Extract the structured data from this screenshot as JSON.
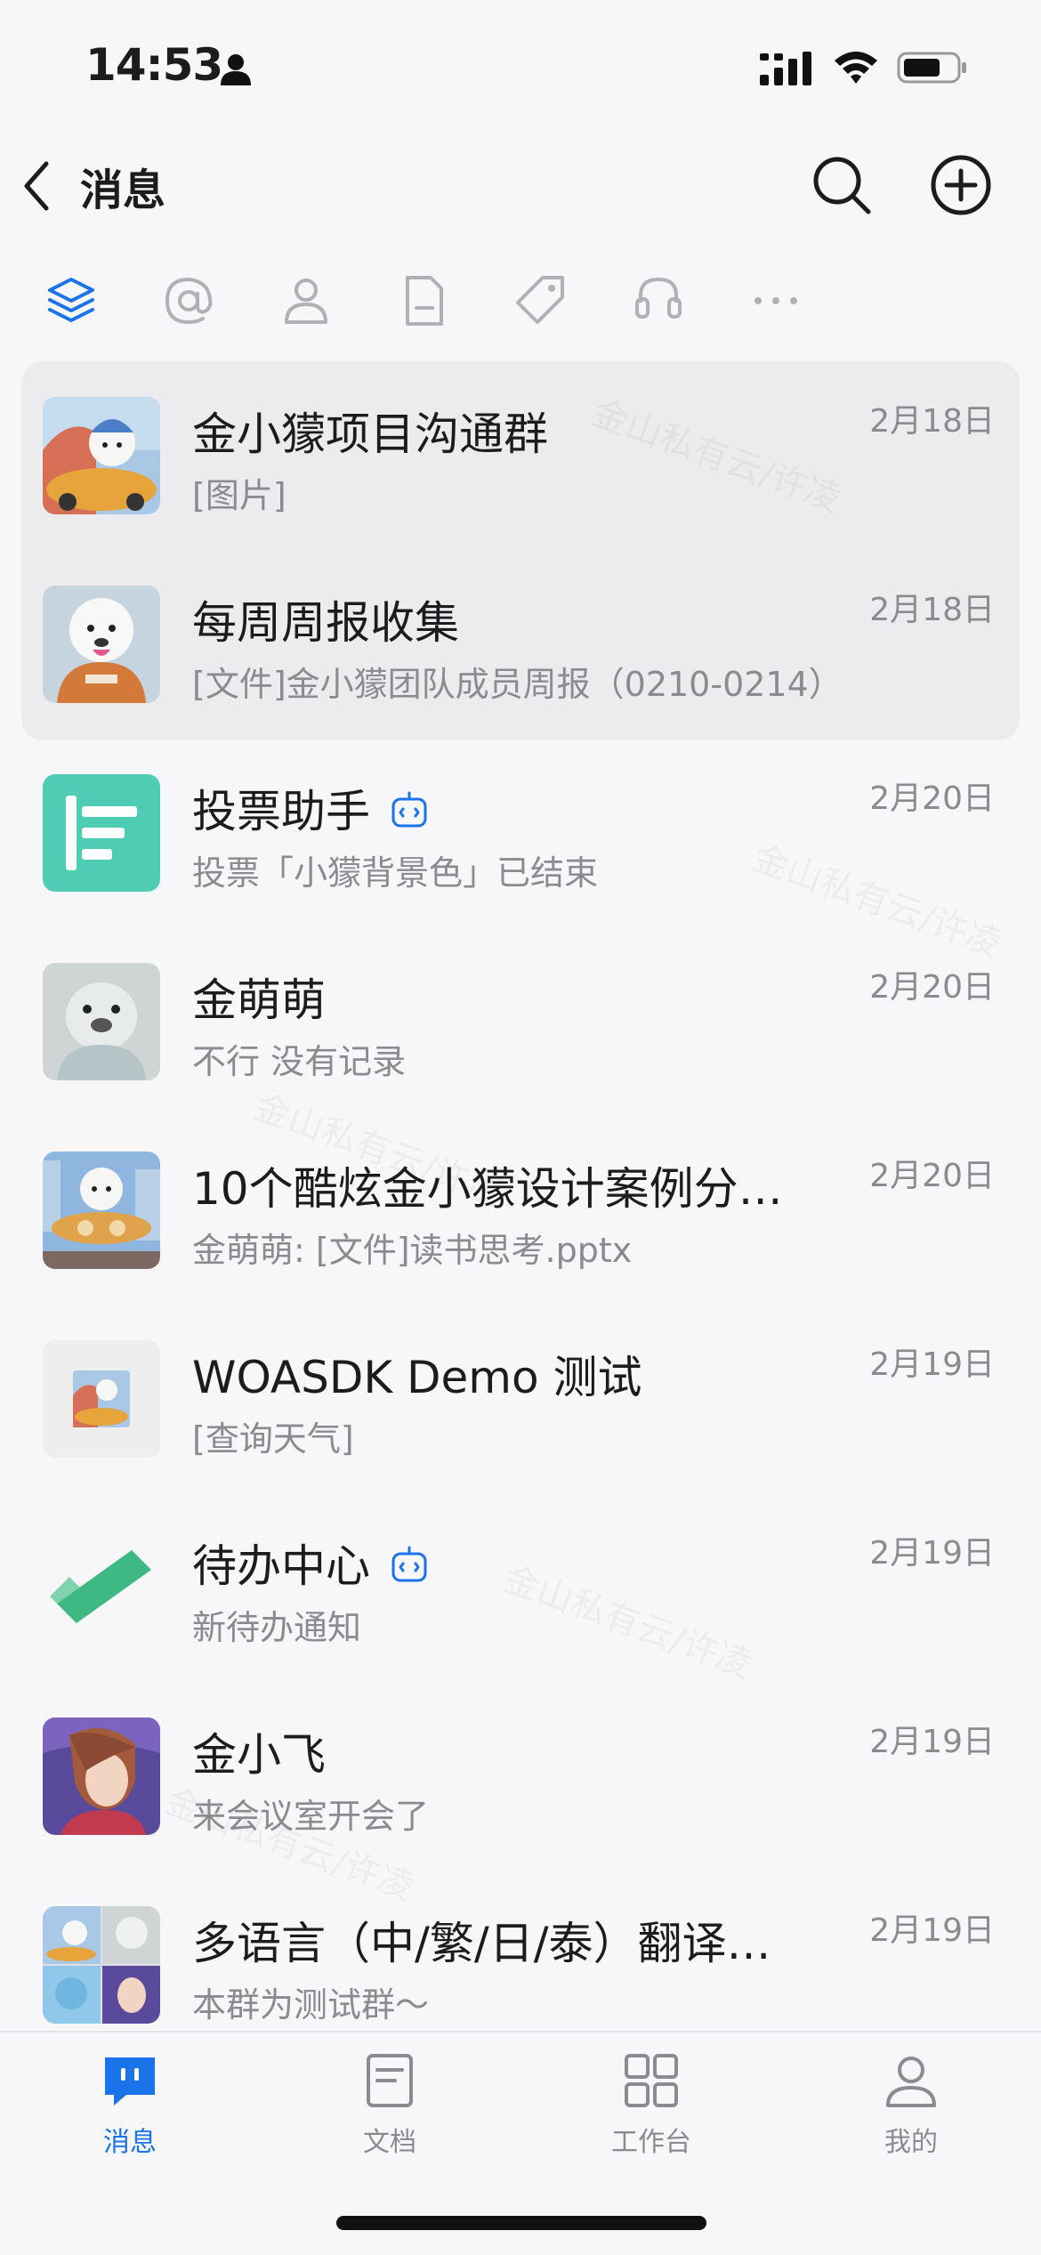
{
  "status_bar": {
    "time": "14:53"
  },
  "nav": {
    "title": "消息"
  },
  "filter_tabs": [
    "all-messages",
    "mentions",
    "single-chats",
    "files",
    "tags",
    "service",
    "more"
  ],
  "chats": [
    {
      "name": "金小獴项目沟通群",
      "preview": "[图片]",
      "date": "2月18日",
      "pinned": true
    },
    {
      "name": "每周周报收集",
      "preview": "[文件]金小獴团队成员周报（0210-0214）",
      "date": "2月18日",
      "pinned": true
    },
    {
      "name": "投票助手",
      "preview": "投票「小獴背景色」已结束",
      "date": "2月20日",
      "bot": true
    },
    {
      "name": "金萌萌",
      "preview": "不行 没有记录",
      "date": "2月20日"
    },
    {
      "name": "10个酷炫金小獴设计案例分…",
      "preview": "金萌萌: [文件]读书思考.pptx",
      "date": "2月20日"
    },
    {
      "name": "WOASDK Demo 测试",
      "preview": "[查询天气]",
      "date": "2月19日"
    },
    {
      "name": "待办中心",
      "preview": "新待办通知",
      "date": "2月19日",
      "bot": true
    },
    {
      "name": "金小飞",
      "preview": "来会议室开会了",
      "date": "2月19日"
    },
    {
      "name": "多语言（中/繁/日/泰）翻译…",
      "preview": "本群为测试群～",
      "date": "2月19日"
    }
  ],
  "watermark": "金山私有云/许凌",
  "tabbar": {
    "messages": "消息",
    "docs": "文档",
    "workbench": "工作台",
    "me": "我的"
  },
  "colors": {
    "accent": "#1a73e8",
    "vote_bot": "#4ecdb4",
    "todo_green": "#3fb984"
  }
}
